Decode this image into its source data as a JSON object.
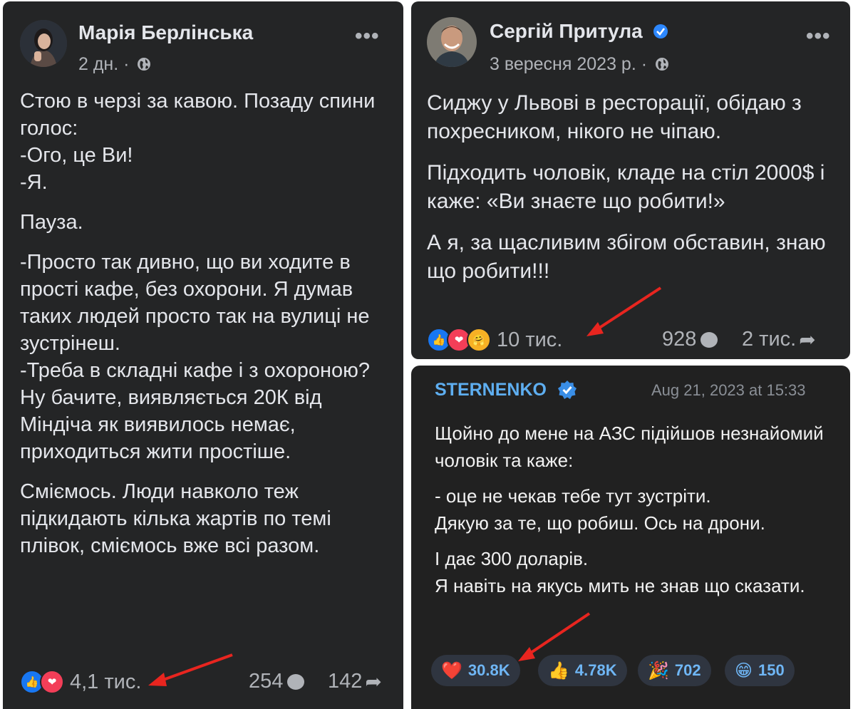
{
  "post1": {
    "author": "Марія Берлінська",
    "time": "2 дн. ·",
    "privacy_icon": "globe-icon",
    "paragraphs": [
      "Стою в черзі за кавою. Позаду спини голос:\n-Ого, це Ви!\n-Я.",
      "Пауза.",
      "-Просто так дивно, що ви ходите в прості кафе, без охорони. Я думав таких людей просто так на вулиці не зустрінеш.\n-Треба в складні кафе і з охороною? Ну бачите, виявляється 20К від Міндіча як виявилось немає, приходиться жити простіше.",
      "Сміємось. Люди навколо теж підкидають кілька жартів по темі плівок, сміємось вже всі разом."
    ],
    "reactions_count": "4,1 тис.",
    "comments_count": "254",
    "shares_count": "142"
  },
  "post2": {
    "author": "Сергій Притула",
    "time": "3 вересня 2023 р. ·",
    "verified_icon": "verified-badge-icon",
    "paragraphs": [
      "Сиджу у Львові в ресторації, обідаю з похресником, нікого не чіпаю.",
      "Підходить чоловік, кладе на стіл 2000$ і каже: «Ви знаєте що робити!»",
      "А я, за щасливим збігом обставин, знаю що робити!!!"
    ],
    "reactions_count": "10 тис.",
    "comments_count": "928",
    "shares_count": "2 тис."
  },
  "post3": {
    "channel": "STERNENKO",
    "date": "Aug 21, 2023 at 15:33",
    "paragraphs": [
      "Щойно до мене на АЗС підійшов незнайомий чоловік та каже:",
      "- оце не чекав тебе тут зустріти.\nДякую за те, що робиш. Ось на дрони.",
      "І дає 300 доларів.\nЯ навіть на якусь мить не знав що сказати."
    ],
    "reactions": [
      {
        "emoji": "❤️",
        "count": "30.8K"
      },
      {
        "emoji": "👍",
        "count": "4.78K"
      },
      {
        "emoji": "🎉",
        "count": "702"
      },
      {
        "emoji": "😁",
        "count": "150"
      }
    ]
  },
  "colors": {
    "fb_bg": "#242526",
    "tg_bg": "#212121",
    "text": "#e4e6eb",
    "muted": "#b0b3b8",
    "like_blue": "#1877f2",
    "love_red": "#f33e58",
    "tg_accent": "#5eaef0",
    "arrow_red": "#e8251f"
  }
}
